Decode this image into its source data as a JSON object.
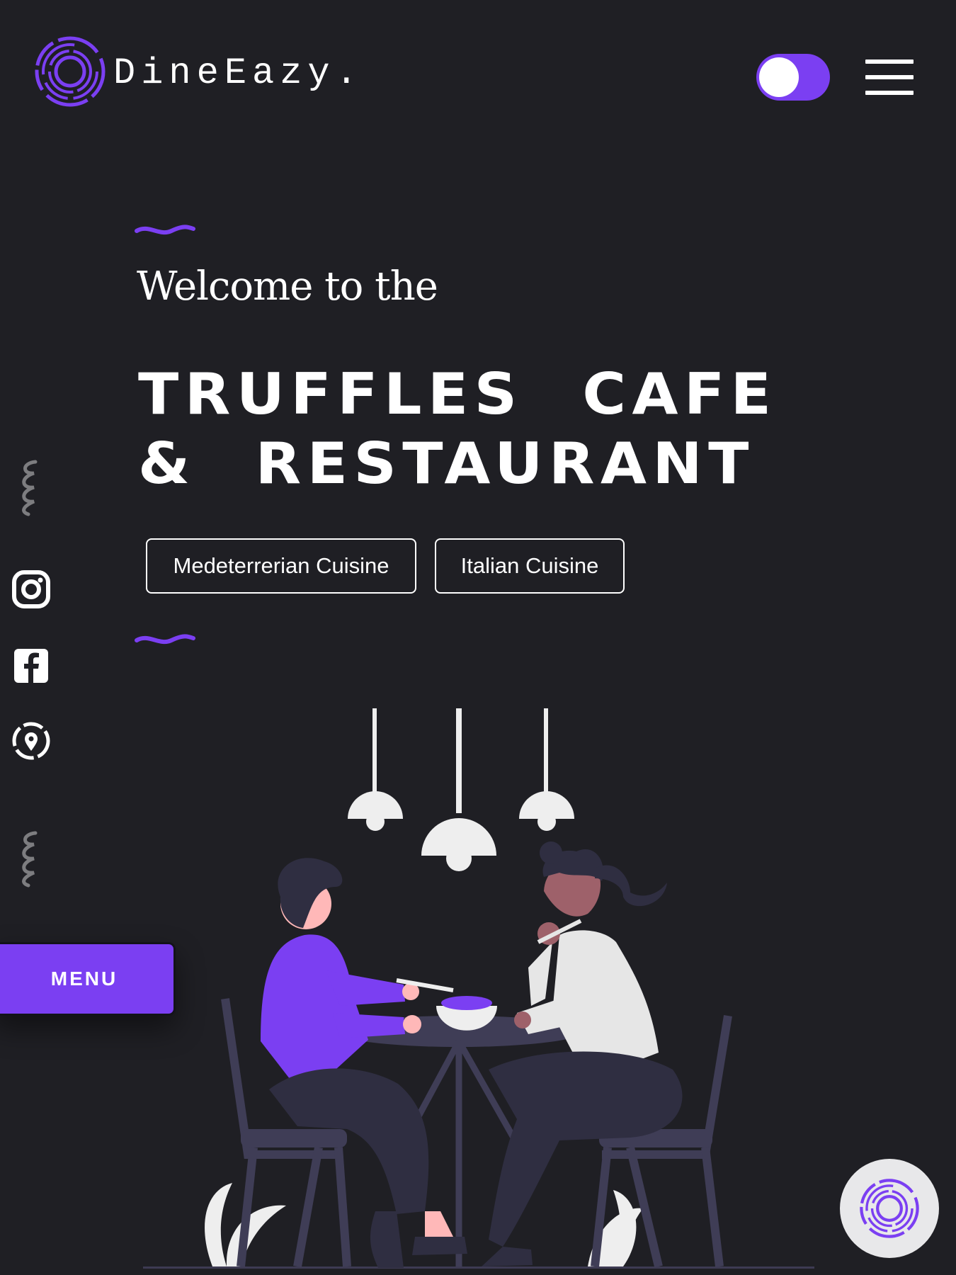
{
  "brand": {
    "name": "DineEazy.",
    "accent_color": "#7b3ff2",
    "background_color": "#1f1f24"
  },
  "header": {
    "theme_toggle_icon": "toggle-switch-icon",
    "menu_icon": "hamburger-menu-icon"
  },
  "hero": {
    "welcome": "Welcome to the",
    "title": "TRUFFLES CAFE & RESTAURANT",
    "tags": [
      {
        "label": "Medeterrerian Cuisine"
      },
      {
        "label": "Italian Cuisine"
      }
    ]
  },
  "social": {
    "icons": [
      "instagram-icon",
      "facebook-icon",
      "location-icon"
    ]
  },
  "menu_button": {
    "label": "MENU"
  },
  "illustration": {
    "description_icon": "dining-couple-illustration"
  }
}
